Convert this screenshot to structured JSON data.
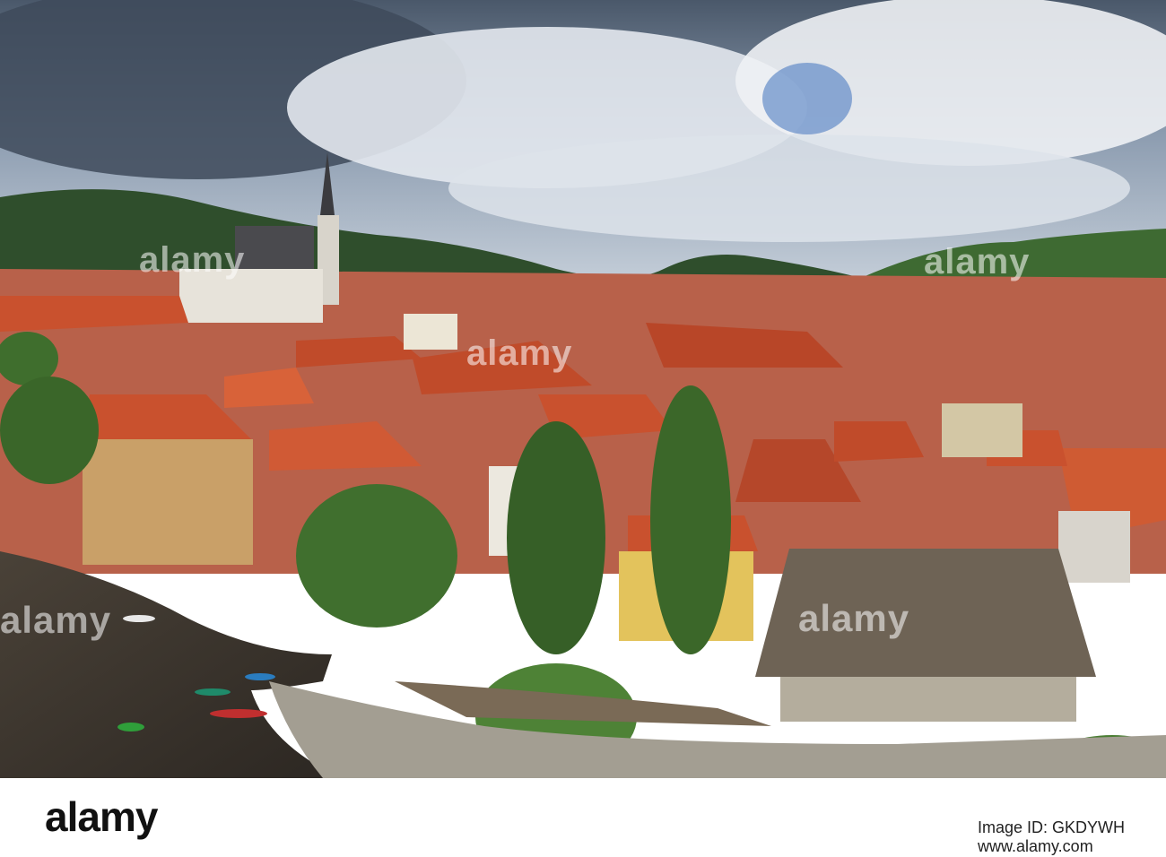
{
  "image": {
    "scene": "aerial view of old town with river, red roofs, church spire and forested hills",
    "colors": {
      "sky": "#8a9bb1",
      "cloud": "#e8ecf1",
      "storm": "#3e4a5a",
      "hill_far": "#2f4e2c",
      "hill_near": "#3e6a32",
      "roof": "#c9512e",
      "roof_dark": "#8e3b22",
      "wall": "#e4d6b8",
      "river": "#3b3630",
      "tree": "#3f6e2d"
    }
  },
  "watermark": {
    "text": "alamy",
    "stock_strip": {
      "brand": "alamy",
      "lines": [
        "Image ID: GKDYWH",
        "www.alamy.com"
      ]
    }
  }
}
